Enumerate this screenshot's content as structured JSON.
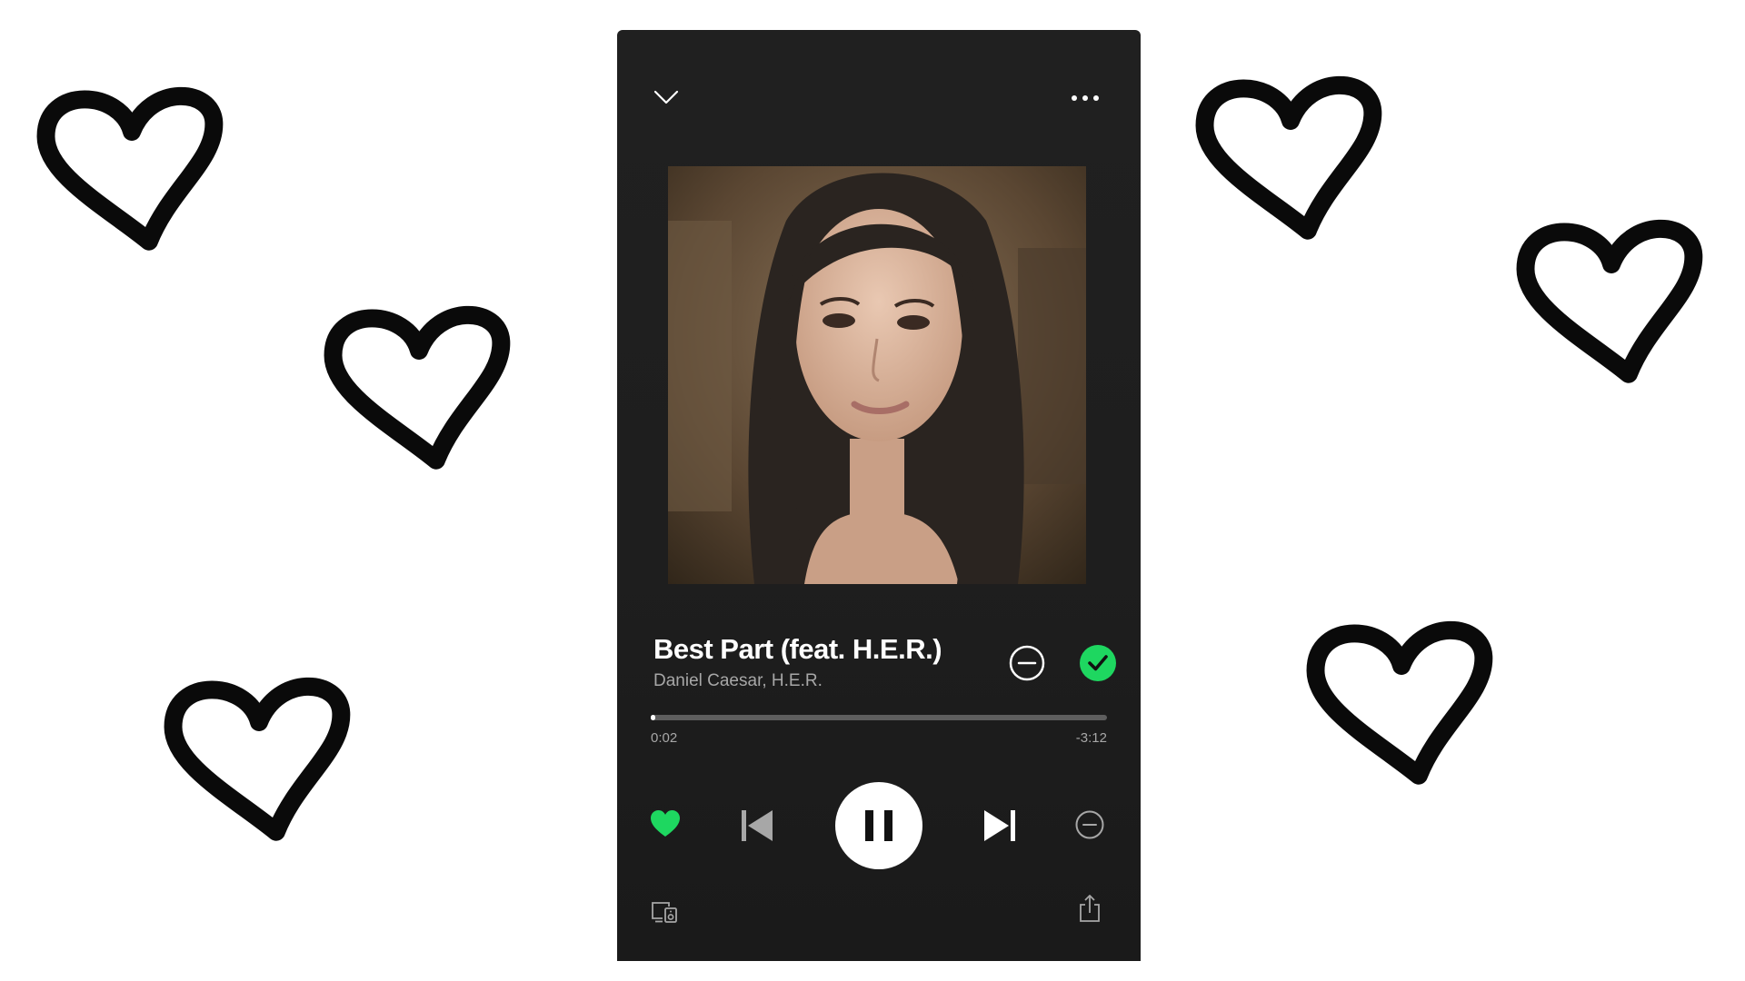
{
  "player": {
    "track_title": "Best Part (feat. H.E.R.)",
    "artist": "Daniel Caesar, H.E.R.",
    "time_elapsed": "0:02",
    "time_remaining": "-3:12",
    "progress_fraction": 0.01,
    "is_playing": true,
    "is_liked": true,
    "is_saved": true
  },
  "icons": {
    "collapse": "chevron-down-icon",
    "more": "more-options-icon",
    "ban": "minus-circle-icon",
    "saved": "checkmark-circle-icon",
    "like": "heart-icon",
    "previous": "skip-previous-icon",
    "pause": "pause-icon",
    "next": "skip-next-icon",
    "hide": "minus-circle-icon",
    "devices": "devices-icon",
    "share": "share-icon"
  },
  "colors": {
    "accent": "#1ed760",
    "background": "#1e1e1e",
    "text_primary": "#ffffff",
    "text_secondary": "#a7a7a7"
  }
}
